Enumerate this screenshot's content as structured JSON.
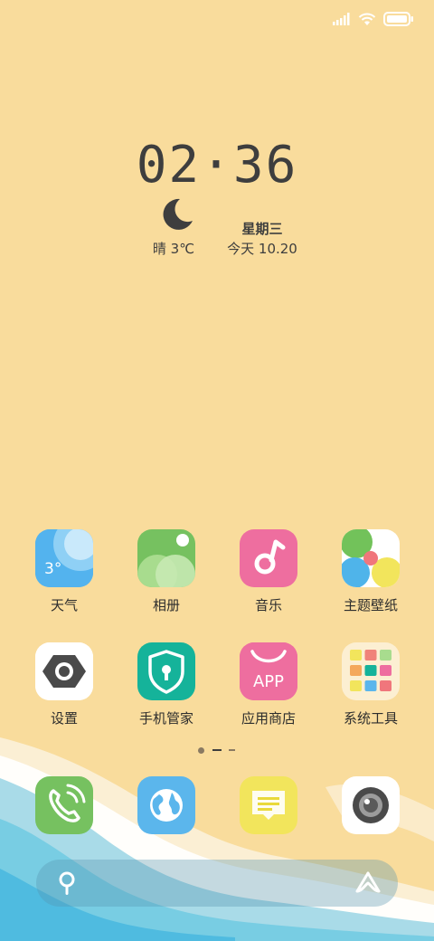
{
  "status_bar": {
    "signal_icon": "signal-icon",
    "wifi_icon": "wifi-icon",
    "battery_icon": "battery-icon"
  },
  "clock": {
    "time": "02·36"
  },
  "weather": {
    "icon": "moon-icon",
    "text": "晴 3℃"
  },
  "date": {
    "weekday": "星期三",
    "day": "今天 10.20"
  },
  "apps": [
    {
      "label": "天气",
      "icon": "weather-icon",
      "badge": "3°"
    },
    {
      "label": "相册",
      "icon": "gallery-icon"
    },
    {
      "label": "音乐",
      "icon": "music-icon"
    },
    {
      "label": "主题壁纸",
      "icon": "themes-icon"
    },
    {
      "label": "设置",
      "icon": "settings-icon"
    },
    {
      "label": "手机管家",
      "icon": "security-icon"
    },
    {
      "label": "应用商店",
      "icon": "app-store-icon",
      "badge": "APP"
    },
    {
      "label": "系统工具",
      "icon": "tools-folder-icon"
    }
  ],
  "page_indicator": {
    "pages": 3,
    "current": 1
  },
  "dock": [
    {
      "icon": "phone-icon"
    },
    {
      "icon": "browser-icon"
    },
    {
      "icon": "messages-icon"
    },
    {
      "icon": "camera-icon"
    }
  ],
  "search_bar": {
    "search_icon": "search-icon",
    "assistant_icon": "assistant-icon"
  },
  "colors": {
    "background": "#f9dc9c",
    "text": "#3e3e3e",
    "sea_light": "#a9dbe8",
    "sea_dark": "#5fc3e2"
  }
}
